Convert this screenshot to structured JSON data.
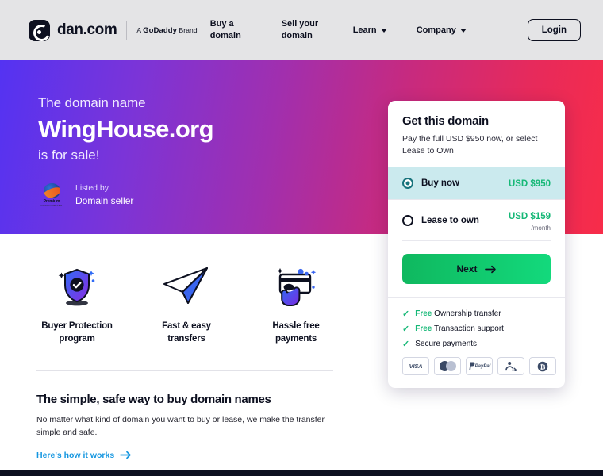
{
  "header": {
    "brand_name": "dan.com",
    "brand_icon": "dan-logo-icon",
    "godaddy_prefix": "A ",
    "godaddy_brand": "GoDaddy",
    "godaddy_suffix": " Brand",
    "nav": [
      {
        "label": "Buy a\ndomain",
        "has_caret": false
      },
      {
        "label": "Sell your\ndomain",
        "has_caret": false
      },
      {
        "label": "Learn",
        "has_caret": true
      },
      {
        "label": "Company",
        "has_caret": true
      }
    ],
    "login_label": "Login"
  },
  "hero": {
    "eyebrow": "The domain name",
    "domain": "WingHouse.org",
    "subtitle": "is for sale!",
    "seller_listed_label": "Listed by",
    "seller_name": "Domain seller",
    "badge_title": "Premium",
    "badge_subtitle": "DOMAIN SELLER",
    "gradient_from": "#5433f2",
    "gradient_to": "#f82c49"
  },
  "card": {
    "title": "Get this domain",
    "description": "Pay the full USD $950 now, or select Lease to Own",
    "options": [
      {
        "label": "Buy now",
        "price": "USD $950",
        "unit": "",
        "selected": true
      },
      {
        "label": "Lease to own",
        "price": "USD $159",
        "unit": "/month",
        "selected": false
      }
    ],
    "next_label": "Next",
    "next_icon": "arrow-right-icon",
    "perks": [
      {
        "highlight": "Free",
        "text": " Ownership transfer"
      },
      {
        "highlight": "Free",
        "text": " Transaction support"
      },
      {
        "highlight": "",
        "text": "Secure payments"
      }
    ],
    "payment_methods": [
      {
        "name": "visa",
        "label": "VISA"
      },
      {
        "name": "mastercard",
        "label": ""
      },
      {
        "name": "paypal",
        "label": "PayPal"
      },
      {
        "name": "bank-transfer",
        "label": ""
      },
      {
        "name": "bitcoin",
        "label": ""
      }
    ],
    "accent_green": "#16b877",
    "selected_bg": "#cbeaee",
    "radio_selected_color": "#17737c"
  },
  "features": [
    {
      "icon": "shield-check-icon",
      "label": "Buyer Protection\nprogram"
    },
    {
      "icon": "paper-plane-icon",
      "label": "Fast & easy\ntransfers"
    },
    {
      "icon": "credit-card-hand-icon",
      "label": "Hassle free\npayments"
    }
  ],
  "bottom": {
    "title": "The simple, safe way to buy domain names",
    "text": "No matter what kind of domain you want to buy or lease, we make the transfer simple and safe.",
    "link_label": "Here's how it works",
    "link_icon": "arrow-right-icon",
    "link_color": "#1496e0"
  }
}
